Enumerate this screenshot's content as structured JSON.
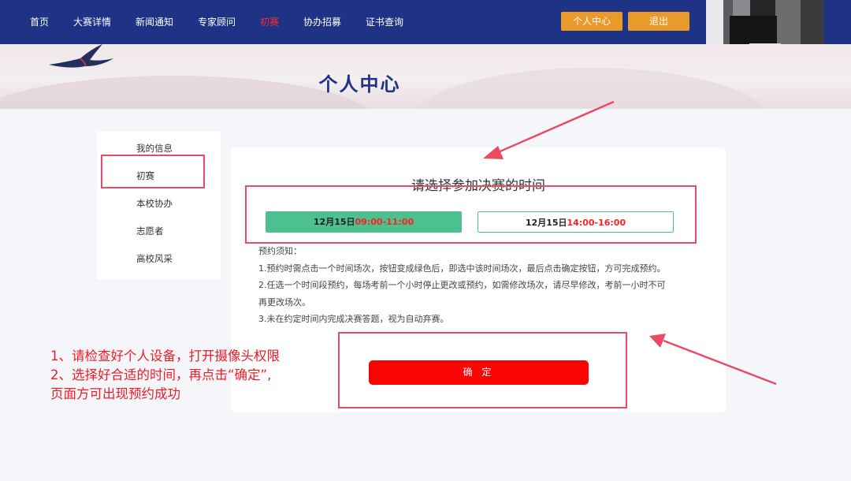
{
  "nav": {
    "items": [
      "首页",
      "大赛详情",
      "新闻通知",
      "专家顾问",
      "初赛",
      "协办招募",
      "证书查询"
    ],
    "active_index": 4,
    "personal_center": "个人中心",
    "logout": "退出"
  },
  "banner": {
    "title": "个人中心"
  },
  "sidebar": {
    "items": [
      "我的信息",
      "初赛",
      "本校协办",
      "志愿者",
      "高校风采"
    ],
    "highlighted_index": 1
  },
  "panel": {
    "title": "请选择参加决赛的时间",
    "slots": [
      {
        "date": "12月15日",
        "time": "09:00-11:00",
        "selected": true
      },
      {
        "date": "12月15日",
        "time": "14:00-16:00",
        "selected": false
      }
    ],
    "notes_title": "预约须知：",
    "notes": [
      "1.预约时需点击一个时间场次，按钮变成绿色后，即选中该时间场次，最后点击确定按钮，方可完成预约。",
      "2.任选一个时间段预约，每场考前一个小时停止更改或预约，如需修改场次，请尽早修改，考前一小时不可",
      "再更改场次。",
      "3.未在约定时间内完成决赛答题，视为自动弃赛。"
    ],
    "confirm_label": "确 定"
  },
  "annotation": {
    "lines": [
      "1、请检查好个人设备，打开摄像头权限",
      "2、选择好合适的时间，再点击“确定”,",
      "页面方可出现预约成功"
    ]
  },
  "colors": {
    "nav_bg": "#1e3386",
    "nav_active": "#ff2a2a",
    "header_button": "#e89a2b",
    "slot_selected": "#4cc08e",
    "slot_time": "#ff2020",
    "confirm": "#fb0303",
    "annotation": "#ee1c25"
  }
}
